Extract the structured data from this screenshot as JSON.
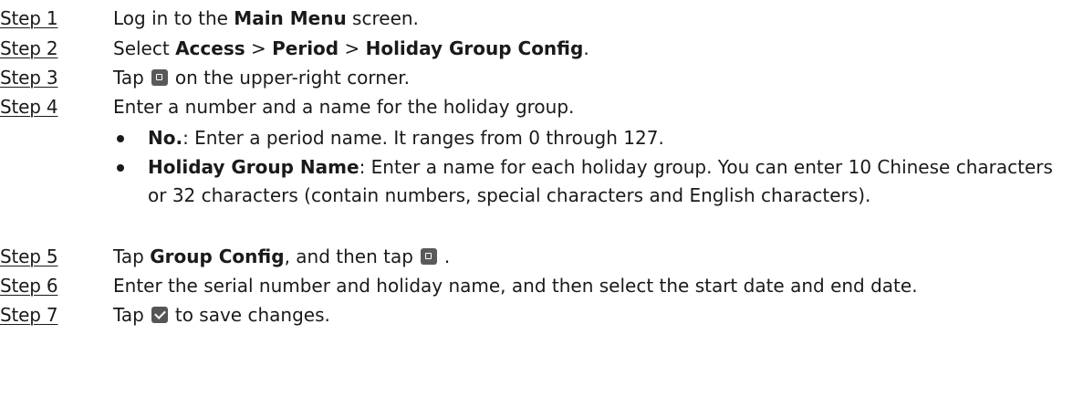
{
  "steps": [
    {
      "label": "Step 1",
      "parts": [
        "Log in to the ",
        "Main Menu",
        " screen."
      ]
    },
    {
      "label": "Step 2",
      "parts": [
        "Select ",
        "Access",
        " > ",
        "Period",
        " > ",
        "Holiday Group Config",
        "."
      ]
    },
    {
      "label": "Step 3",
      "parts": [
        "Tap",
        "on the upper-right corner."
      ]
    },
    {
      "label": "Step 4",
      "parts": [
        "Enter a number and a name for the holiday group."
      ]
    },
    {
      "label": "Step 5",
      "parts": [
        "Tap ",
        "Group Config",
        ", and then tap",
        "."
      ]
    },
    {
      "label": "Step 6",
      "parts": [
        "Enter the serial number and holiday name, and then select the start date and end date."
      ]
    },
    {
      "label": "Step 7",
      "parts": [
        "Tap",
        "to save changes."
      ]
    }
  ],
  "bullets": [
    {
      "term": "No.",
      "text": ": Enter a period name. It ranges from 0 through 127."
    },
    {
      "term": "Holiday Group Name",
      "text": ": Enter a name for each holiday group. You can enter 10 Chinese characters or 32 characters (contain numbers, special characters and English characters)."
    }
  ],
  "icons": {
    "add": "add-icon",
    "confirm": "checkmark-icon"
  }
}
